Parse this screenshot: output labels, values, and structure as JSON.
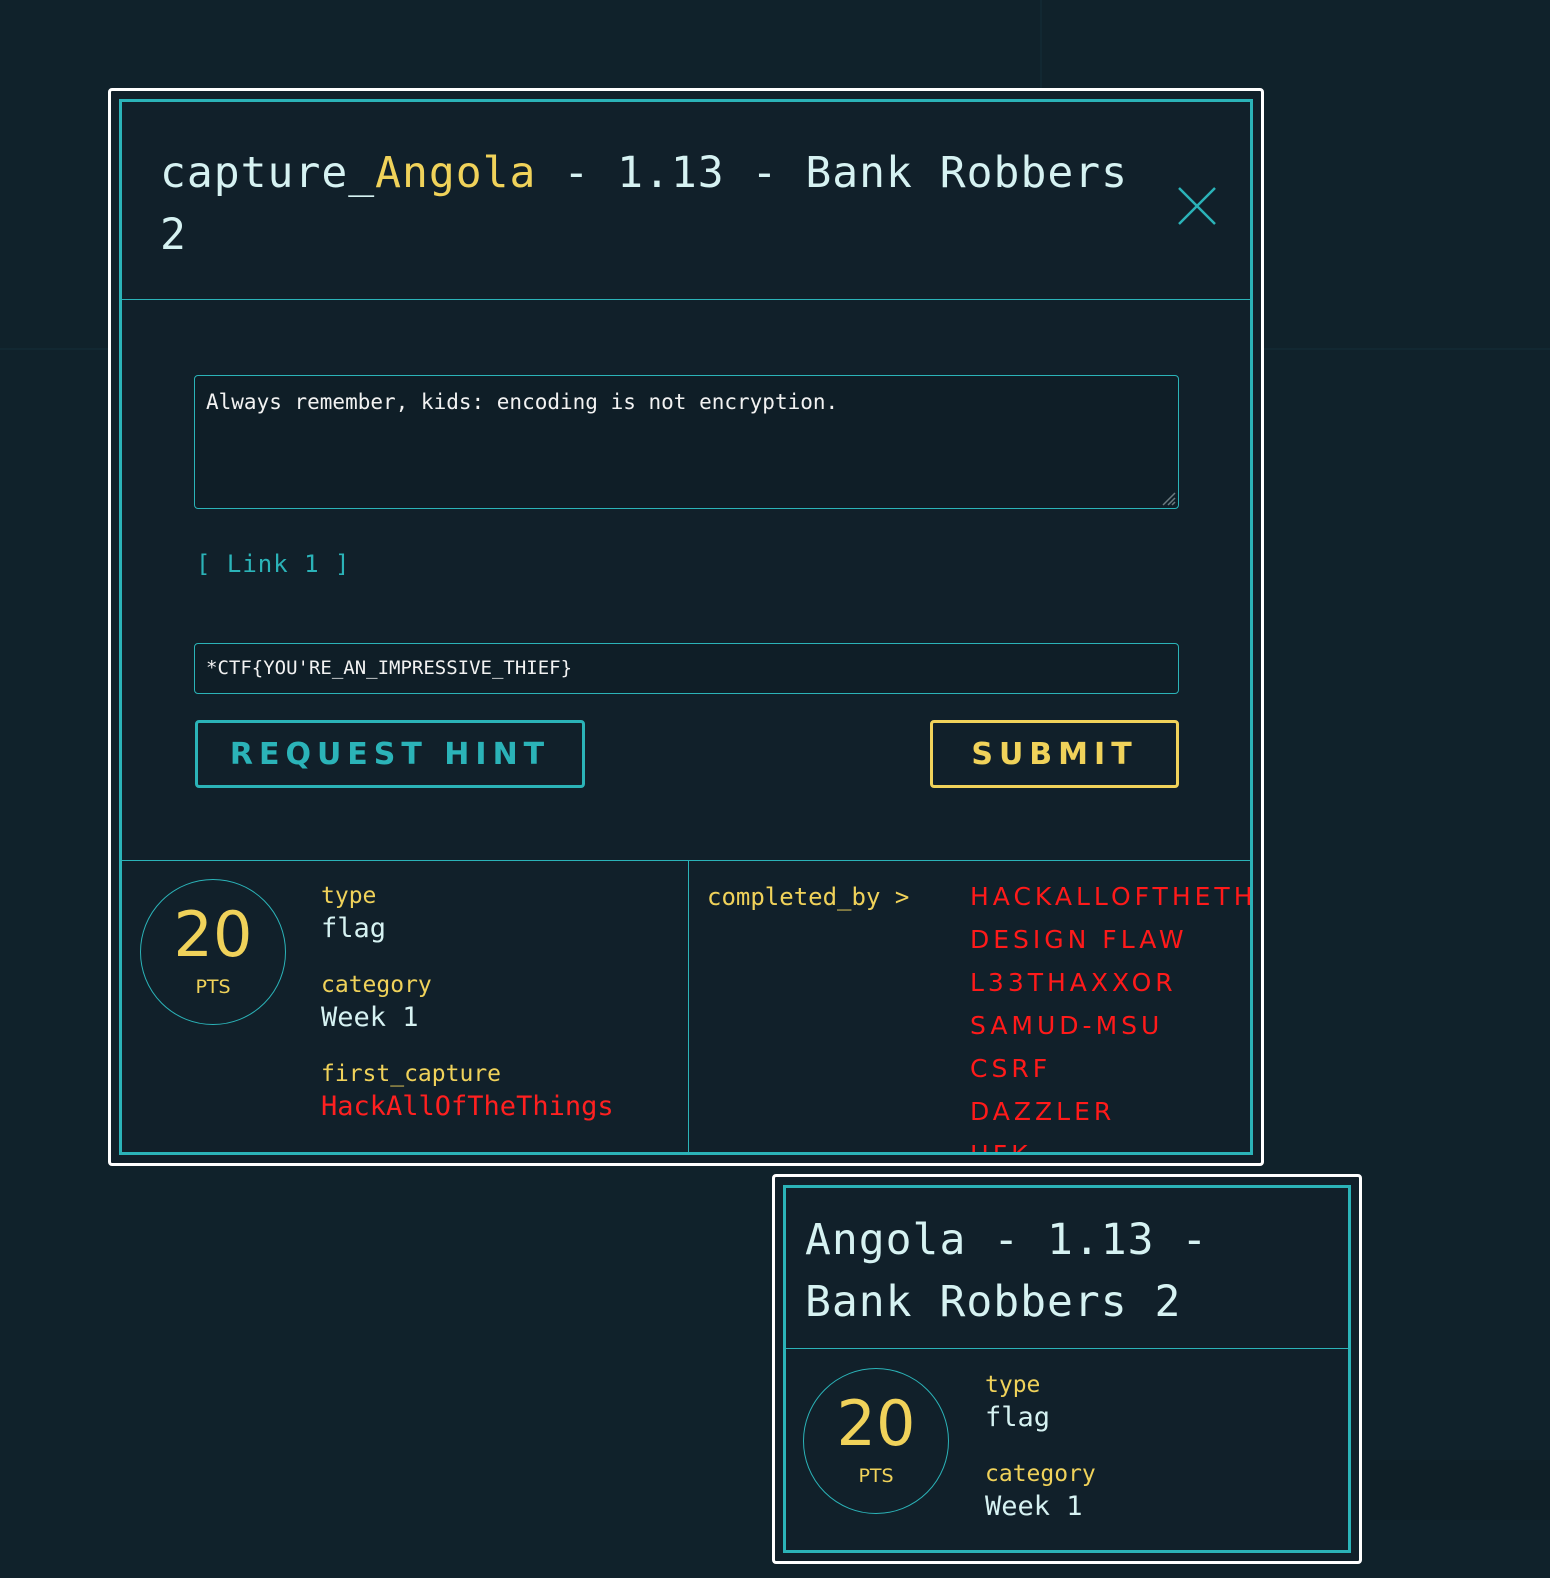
{
  "modal": {
    "title_prefix": "capture_",
    "title_accent": "Angola",
    "title_rest": " - 1.13 - Bank Robbers 2",
    "description": "Always remember, kids: encoding is not encryption.",
    "link_label": "[ Link 1 ]",
    "flag_value": "*CTF{YOU'RE_AN_IMPRESSIVE_THIEF}",
    "request_hint_label": "REQUEST HINT",
    "submit_label": "SUBMIT",
    "points": "20",
    "points_unit": "PTS",
    "type_key": "type",
    "type_value": "flag",
    "category_key": "category",
    "category_value": "Week 1",
    "first_capture_key": "first_capture",
    "first_capture_value": "HackAllOfTheThings",
    "completed_by_label": "completed_by >",
    "completed_by": [
      "HACKALLOFTHETH",
      "DESIGN FLAW",
      "L33THAXXOR",
      "SAMUD-MSU",
      "CSRF",
      "DAZZLER",
      "HFK"
    ]
  },
  "card": {
    "title": "Angola - 1.13 - Bank Robbers 2",
    "points": "20",
    "points_unit": "PTS",
    "type_key": "type",
    "type_value": "flag",
    "category_key": "category",
    "category_value": "Week 1"
  },
  "icons": {
    "close": "close-icon",
    "resize": "resize-grip-icon"
  },
  "colors": {
    "accent_teal": "#2bb3b8",
    "accent_yellow": "#f0d25a",
    "alert_red": "#ff2020",
    "background": "#10222b"
  }
}
